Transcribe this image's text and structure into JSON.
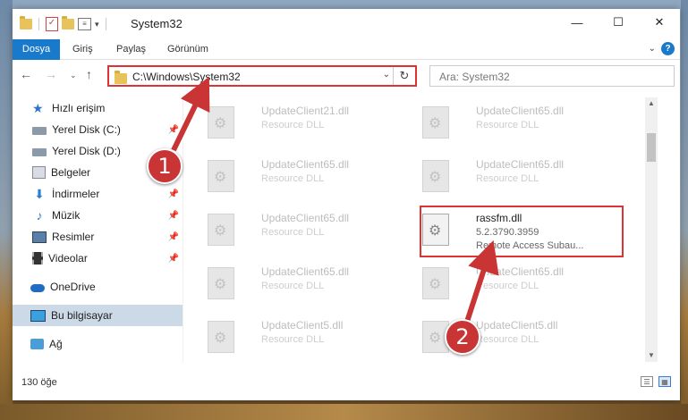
{
  "window": {
    "title": "System32"
  },
  "ribbon": {
    "tabs": [
      "Dosya",
      "Giriş",
      "Paylaş",
      "Görünüm"
    ]
  },
  "address": {
    "path": "C:\\Windows\\System32"
  },
  "search": {
    "placeholder": "Ara: System32"
  },
  "sidebar": {
    "items": [
      {
        "label": "Hızlı erişim",
        "icon": "star-icon"
      },
      {
        "label": "Yerel Disk (C:)",
        "icon": "drive-icon",
        "pinned": true
      },
      {
        "label": "Yerel Disk (D:)",
        "icon": "drive-icon",
        "pinned": true
      },
      {
        "label": "Belgeler",
        "icon": "document-icon",
        "pinned": true
      },
      {
        "label": "İndirmeler",
        "icon": "download-icon",
        "pinned": true
      },
      {
        "label": "Müzik",
        "icon": "music-icon",
        "pinned": true
      },
      {
        "label": "Resimler",
        "icon": "pictures-icon",
        "pinned": true
      },
      {
        "label": "Videolar",
        "icon": "video-icon",
        "pinned": true
      },
      {
        "label": "OneDrive",
        "icon": "cloud-icon"
      },
      {
        "label": "Bu bilgisayar",
        "icon": "computer-icon",
        "selected": true
      },
      {
        "label": "Ağ",
        "icon": "network-icon"
      }
    ]
  },
  "files": [
    {
      "name": "UpdateClient21.dll",
      "desc": "Resource DLL"
    },
    {
      "name": "UpdateClient65.dll",
      "desc": "Resource DLL"
    },
    {
      "name": "UpdateClient65.dll",
      "desc": "Resource DLL"
    },
    {
      "name": "UpdateClient65.dll",
      "desc": "Resource DLL"
    },
    {
      "name": "UpdateClient65.dll",
      "desc": "Resource DLL"
    },
    {
      "name": "rassfm.dll",
      "desc": "5.2.3790.3959",
      "desc2": "Remote Access Subau...",
      "active": true
    },
    {
      "name": "UpdateClient65.dll",
      "desc": "Resource DLL"
    },
    {
      "name": "UpdateClient65.dll",
      "desc": "Resource DLL"
    },
    {
      "name": "UpdateClient5.dll",
      "desc": "Resource DLL"
    },
    {
      "name": "UpdateClient5.dll",
      "desc": "Resource DLL"
    }
  ],
  "status": {
    "count": "130 öğe"
  },
  "annotations": {
    "badge1": "1",
    "badge2": "2"
  },
  "colors": {
    "accent": "#1979ca",
    "highlight": "#d33333",
    "selected": "#ccd9e6"
  }
}
